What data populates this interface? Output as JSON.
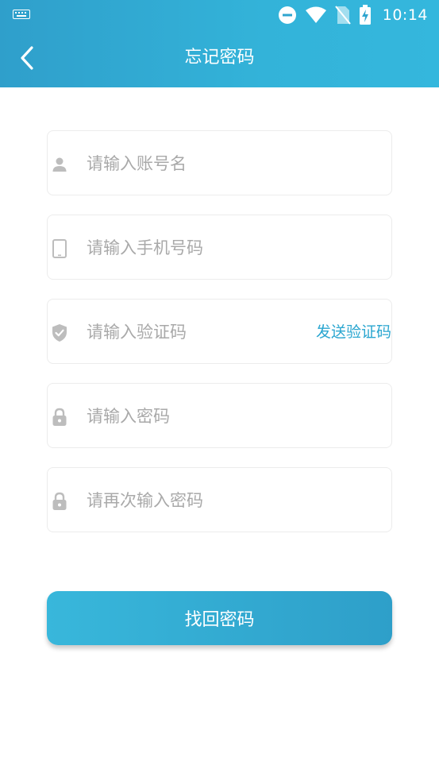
{
  "status_bar": {
    "time": "10:14",
    "icons": [
      "keyboard-icon",
      "do-not-disturb-icon",
      "wifi-icon",
      "no-sim-icon",
      "battery-charging-icon"
    ]
  },
  "header": {
    "title": "忘记密码",
    "back_icon": "chevron-left-icon"
  },
  "form": {
    "fields": [
      {
        "icon": "user-icon",
        "placeholder": "请输入账号名",
        "value": ""
      },
      {
        "icon": "phone-icon",
        "placeholder": "请输入手机号码",
        "value": ""
      },
      {
        "icon": "shield-check-icon",
        "placeholder": "请输入验证码",
        "value": "",
        "action_label": "发送验证码"
      },
      {
        "icon": "lock-icon",
        "placeholder": "请输入密码",
        "value": ""
      },
      {
        "icon": "lock-icon",
        "placeholder": "请再次输入密码",
        "value": ""
      }
    ],
    "submit_label": "找回密码"
  },
  "colors": {
    "primary": "#33b3d9",
    "primary_dark": "#2e9fc9",
    "link": "#2aa6d0",
    "placeholder": "#a9a9a9",
    "icon_gray": "#bdbdbd"
  }
}
